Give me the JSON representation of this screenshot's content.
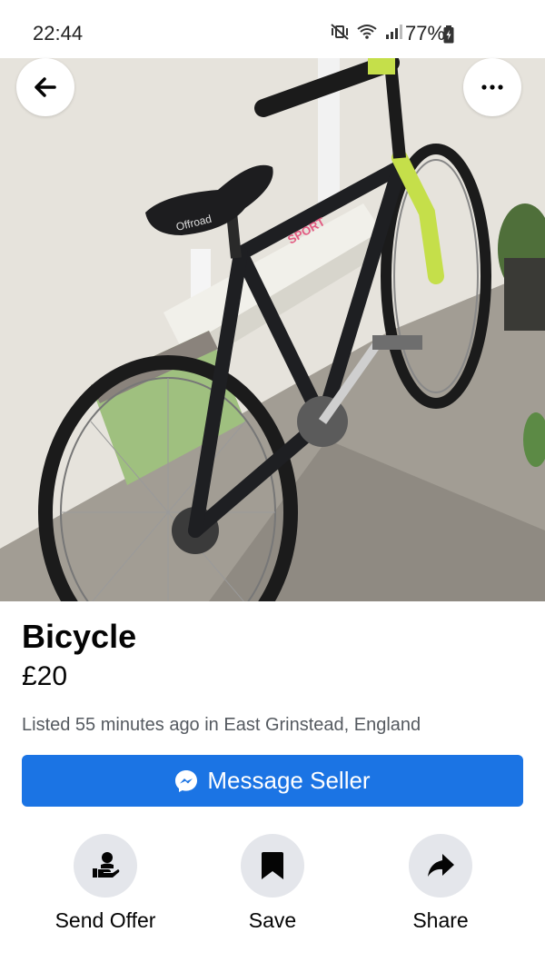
{
  "status_bar": {
    "time": "22:44",
    "battery_percent": "77%",
    "icons": [
      "mute-vibrate-icon",
      "wifi-icon",
      "signal-icon",
      "battery-icon"
    ]
  },
  "listing": {
    "title": "Bicycle",
    "price": "£20",
    "meta": "Listed 55 minutes ago in East Grinstead, England"
  },
  "photo": {
    "seat_text": "Offroad",
    "frame_text": "SPORT"
  },
  "actions": {
    "message_seller": "Message Seller",
    "send_offer": "Send Offer",
    "save": "Save",
    "share": "Share"
  },
  "colors": {
    "primary_button": "#1b74e4",
    "action_circle": "#e4e6eb"
  }
}
